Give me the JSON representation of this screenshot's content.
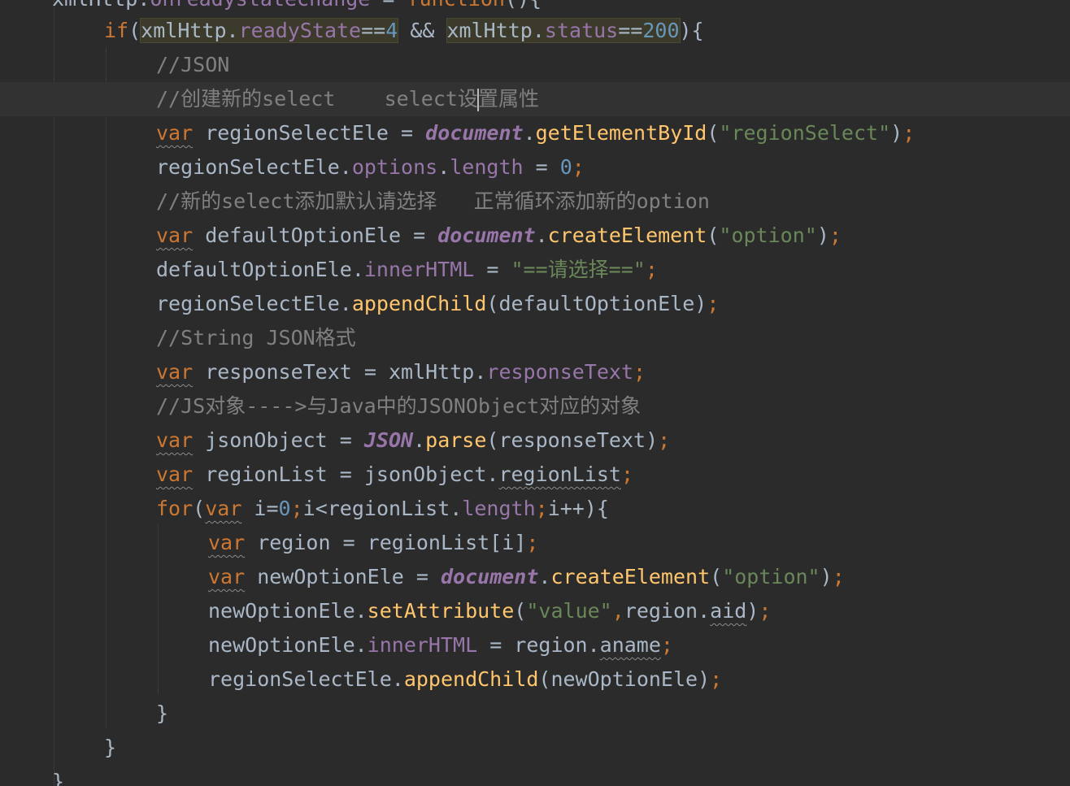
{
  "editor": {
    "language": "JavaScript",
    "theme": {
      "background": "#2b2b2b",
      "current_line": "#323232",
      "keyword": "#cc7832",
      "function": "#ffc66d",
      "number": "#6897bb",
      "string": "#6a8759",
      "property": "#9876aa",
      "comment": "#808080",
      "text": "#a9b7c6"
    },
    "lines": [
      "xmlHttp.onreadystatechange = function(){",
      "    if(xmlHttp.readyState==4 && xmlHttp.status==200){",
      "        //JSON",
      "        //创建新的select    select设置属性",
      "        var regionSelectEle = document.getElementById(\"regionSelect\");",
      "        regionSelectEle.options.length = 0;",
      "        //新的select添加默认请选择   正常循环添加新的option",
      "        var defaultOptionEle = document.createElement(\"option\");",
      "        defaultOptionEle.innerHTML = \"==请选择==\";",
      "        regionSelectEle.appendChild(defaultOptionEle);",
      "        //String JSON格式",
      "        var responseText = xmlHttp.responseText;",
      "        //JS对象---->与Java中的JSONObject对应的对象",
      "        var jsonObject = JSON.parse(responseText);",
      "        var regionList = jsonObject.regionList;",
      "        for(var i=0;i<regionList.length;i++){",
      "            var region = regionList[i];",
      "            var newOptionEle = document.createElement(\"option\");",
      "            newOptionEle.setAttribute(\"value\",region.aid);",
      "            newOptionEle.innerHTML = region.aname;",
      "            regionSelectEle.appendChild(newOptionEle);",
      "        }",
      "    }",
      "}"
    ]
  }
}
